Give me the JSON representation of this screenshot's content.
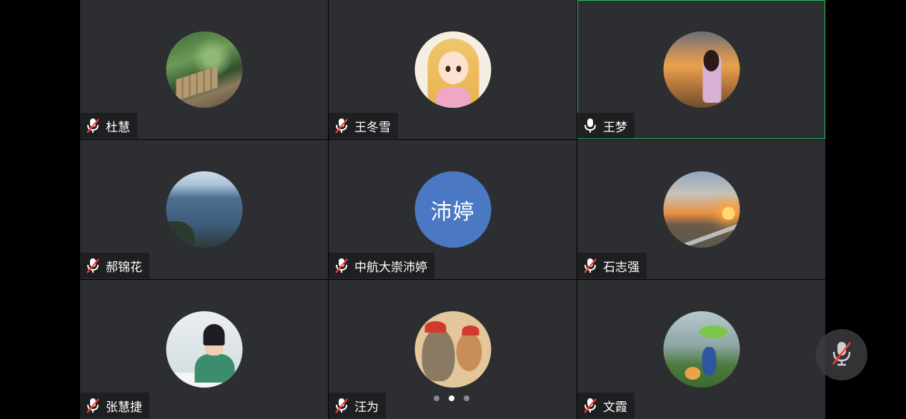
{
  "participants": [
    {
      "name": "杜慧",
      "muted": true,
      "speaking": false,
      "avatar": "forest-bench-photo"
    },
    {
      "name": "王冬雪",
      "muted": true,
      "speaking": false,
      "avatar": "cartoon-girl"
    },
    {
      "name": "王梦",
      "muted": false,
      "speaking": true,
      "avatar": "sunset-girl-photo"
    },
    {
      "name": "郝锦花",
      "muted": true,
      "speaking": false,
      "avatar": "lake-photo"
    },
    {
      "name": "中航大崇沛婷",
      "muted": true,
      "speaking": false,
      "avatar_text": "沛婷"
    },
    {
      "name": "石志强",
      "muted": true,
      "speaking": false,
      "avatar": "dusk-landscape-photo"
    },
    {
      "name": "张慧捷",
      "muted": true,
      "speaking": false,
      "avatar": "child-painting-photo"
    },
    {
      "name": "汪为",
      "muted": true,
      "speaking": false,
      "avatar": "totoro-illustration"
    },
    {
      "name": "文霞",
      "muted": true,
      "speaking": false,
      "avatar": "rain-cartoon"
    }
  ],
  "pager": {
    "pages": 3,
    "current": 2
  },
  "controls": {
    "mic_button_icon": "microphone-off-icon"
  },
  "colors": {
    "tile_bg": "#2d2e31",
    "speaking_border": "#1fc25b",
    "text_avatar_bg": "#4a78c2",
    "muted_icon": "#ff3b30"
  }
}
